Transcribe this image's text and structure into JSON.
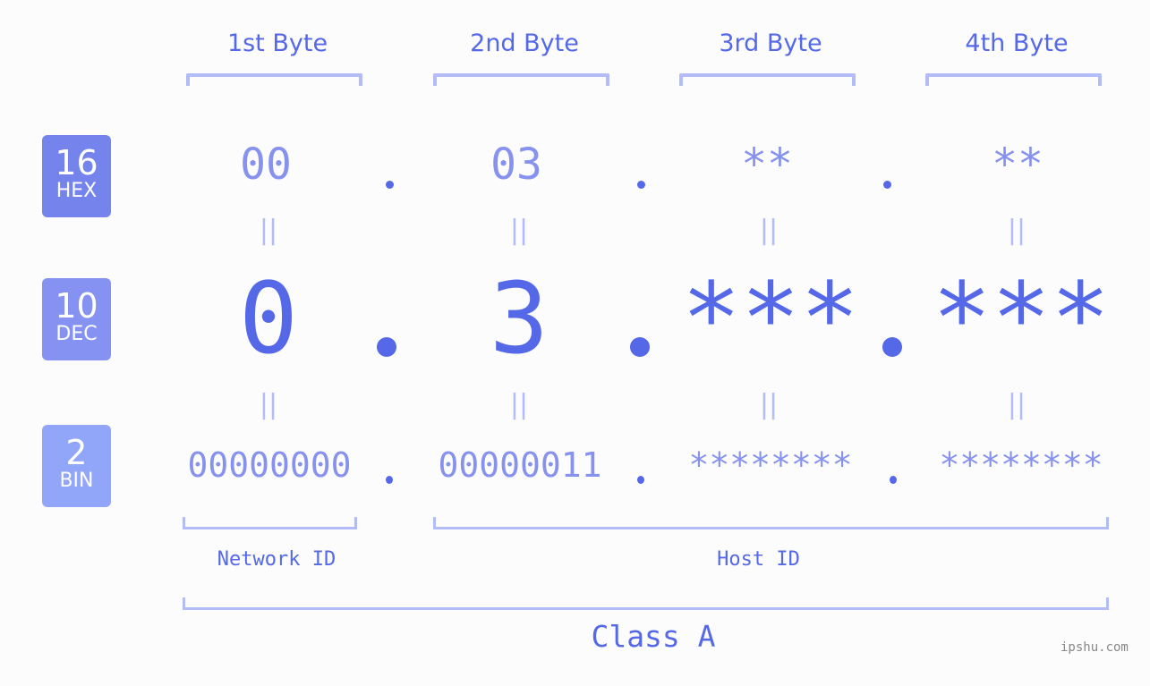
{
  "byte_headers": [
    "1st Byte",
    "2nd Byte",
    "3rd Byte",
    "4th Byte"
  ],
  "badges": [
    {
      "number": "16",
      "label": "HEX",
      "color": "#7584ec"
    },
    {
      "number": "10",
      "label": "DEC",
      "color": "#8592f1"
    },
    {
      "number": "2",
      "label": "BIN",
      "color": "#91a6f9"
    }
  ],
  "hex": [
    "00",
    "03",
    "**",
    "**"
  ],
  "dec": [
    "0",
    "3",
    "***",
    "***"
  ],
  "bin": [
    "00000000",
    "00000011",
    "********",
    "********"
  ],
  "equals_sign": "||",
  "network_label": "Network ID",
  "host_label": "Host ID",
  "class_label": "Class A",
  "watermark": "ipshu.com",
  "colors": {
    "accent": "#5468e8",
    "light": "#8792ee",
    "bracket": "#b3bcf6",
    "background": "#fbfcfb"
  }
}
